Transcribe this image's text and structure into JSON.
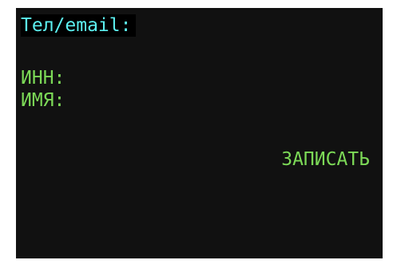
{
  "form": {
    "phone_email_label": "Тел/email:",
    "inn_label": "ИНН:",
    "name_label": "ИМЯ:",
    "submit_label": "ЗАПИСАТЬ"
  },
  "colors": {
    "background": "#111111",
    "active_field_text": "#5cf0f0",
    "field_text": "#7cd957"
  }
}
